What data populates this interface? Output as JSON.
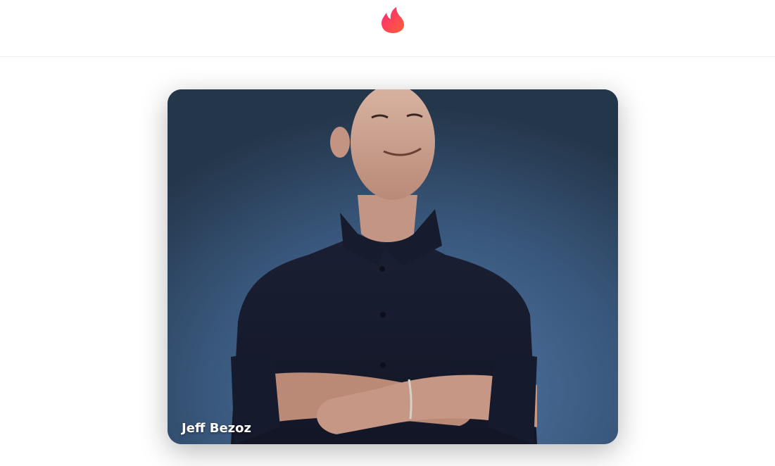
{
  "header": {
    "logo_icon": "flame-icon",
    "logo_gradient": [
      "#fd267a",
      "#ff6036"
    ]
  },
  "card": {
    "name": "Jeff Bezoz",
    "background_colors": [
      "#2b3d50",
      "#4a6c98"
    ]
  }
}
